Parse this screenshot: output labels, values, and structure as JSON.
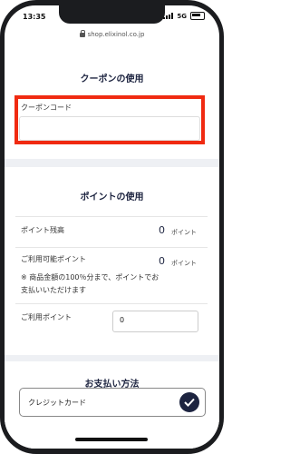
{
  "status": {
    "time": "13:35",
    "network": "5G"
  },
  "browser": {
    "url": "shop.elixinol.co.jp"
  },
  "coupon": {
    "title": "クーポンの使用",
    "field_label": "クーポンコード",
    "value": ""
  },
  "points": {
    "title": "ポイントの使用",
    "balance_label": "ポイント残高",
    "balance_value": "0",
    "available_label": "ご利用可能ポイント",
    "available_value": "0",
    "unit": "ポイント",
    "note_line1": "※ 商品金額の100％分まで、ポイントでお",
    "note_line2": "支払いいただけます",
    "use_label": "ご利用ポイント",
    "use_value": "0"
  },
  "payment": {
    "title": "お支払い方法",
    "method": "クレジットカード",
    "selected": true
  },
  "colors": {
    "accent": "#1d2440",
    "highlight": "#f02a11"
  }
}
